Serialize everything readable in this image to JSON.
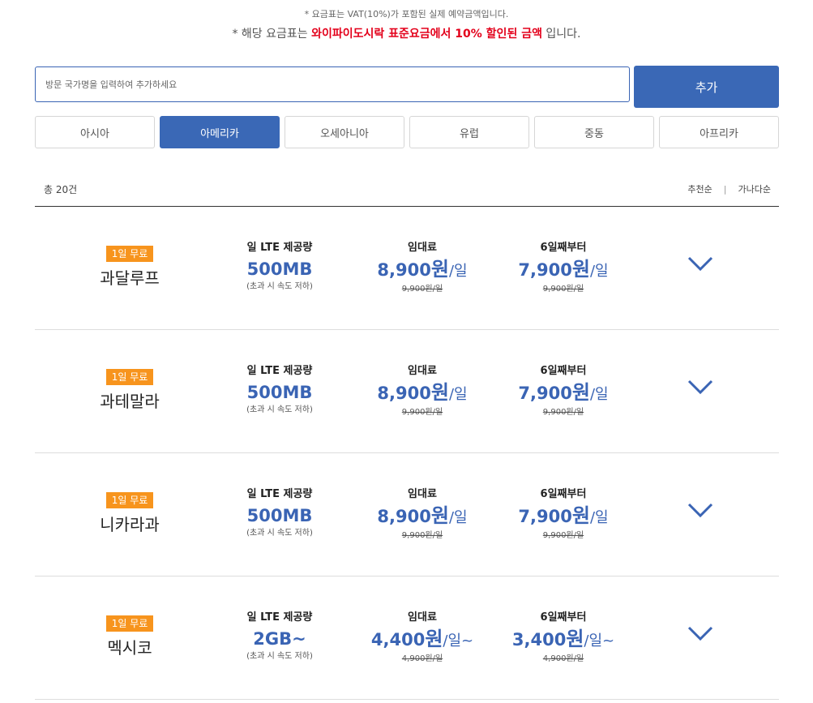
{
  "notice": {
    "line1": "* 요금표는 VAT(10%)가 포함된 실제 예약금액입니다.",
    "line2_prefix": "* 해당 요금표는 ",
    "line2_highlight": "와이파이도시락 표준요금에서 10% 할인된 금액",
    "line2_suffix": " 입니다."
  },
  "search": {
    "placeholder": "방문 국가명을 입력하여 추가하세요",
    "value": "",
    "button_label": "추가"
  },
  "tabs": [
    {
      "label": "아시아",
      "active": false
    },
    {
      "label": "아메리카",
      "active": true
    },
    {
      "label": "오세아니아",
      "active": false
    },
    {
      "label": "유럽",
      "active": false
    },
    {
      "label": "중동",
      "active": false
    },
    {
      "label": "아프리카",
      "active": false
    }
  ],
  "list_header": {
    "count": "총 20건",
    "sort_recommended": "추천순",
    "sort_separator": "|",
    "sort_alphabetical": "가나다순"
  },
  "colors": {
    "accent": "#3a68b6",
    "badge": "#f7941d",
    "highlight": "#e3001b"
  },
  "items": [
    {
      "badge": "1일 무료",
      "country": "과달루프",
      "data_header": "일 LTE 제공량",
      "data_amount": "500MB",
      "data_note": "(초과 시 속도 저하)",
      "rent_header": "임대료",
      "rent_price": "8,900",
      "rent_won": "원",
      "rent_unit": "/일",
      "rent_original": "9,900원/일",
      "after_header": "6일째부터",
      "after_price": "7,900",
      "after_won": "원",
      "after_unit": "/일",
      "after_original": "9,900원/일",
      "expand_icon": "chevron-down-icon"
    },
    {
      "badge": "1일 무료",
      "country": "과테말라",
      "data_header": "일 LTE 제공량",
      "data_amount": "500MB",
      "data_note": "(초과 시 속도 저하)",
      "rent_header": "임대료",
      "rent_price": "8,900",
      "rent_won": "원",
      "rent_unit": "/일",
      "rent_original": "9,900원/일",
      "after_header": "6일째부터",
      "after_price": "7,900",
      "after_won": "원",
      "after_unit": "/일",
      "after_original": "9,900원/일",
      "expand_icon": "chevron-down-icon"
    },
    {
      "badge": "1일 무료",
      "country": "니카라과",
      "data_header": "일 LTE 제공량",
      "data_amount": "500MB",
      "data_note": "(초과 시 속도 저하)",
      "rent_header": "임대료",
      "rent_price": "8,900",
      "rent_won": "원",
      "rent_unit": "/일",
      "rent_original": "9,900원/일",
      "after_header": "6일째부터",
      "after_price": "7,900",
      "after_won": "원",
      "after_unit": "/일",
      "after_original": "9,900원/일",
      "expand_icon": "chevron-down-icon"
    },
    {
      "badge": "1일 무료",
      "country": "멕시코",
      "data_header": "일 LTE 제공량",
      "data_amount": "2GB~",
      "data_note": "(초과 시 속도 저하)",
      "rent_header": "임대료",
      "rent_price": "4,400",
      "rent_won": "원",
      "rent_unit": "/일~",
      "rent_original": "4,900원/일",
      "after_header": "6일째부터",
      "after_price": "3,400",
      "after_won": "원",
      "after_unit": "/일~",
      "after_original": "4,900원/일",
      "expand_icon": "chevron-down-icon"
    }
  ]
}
